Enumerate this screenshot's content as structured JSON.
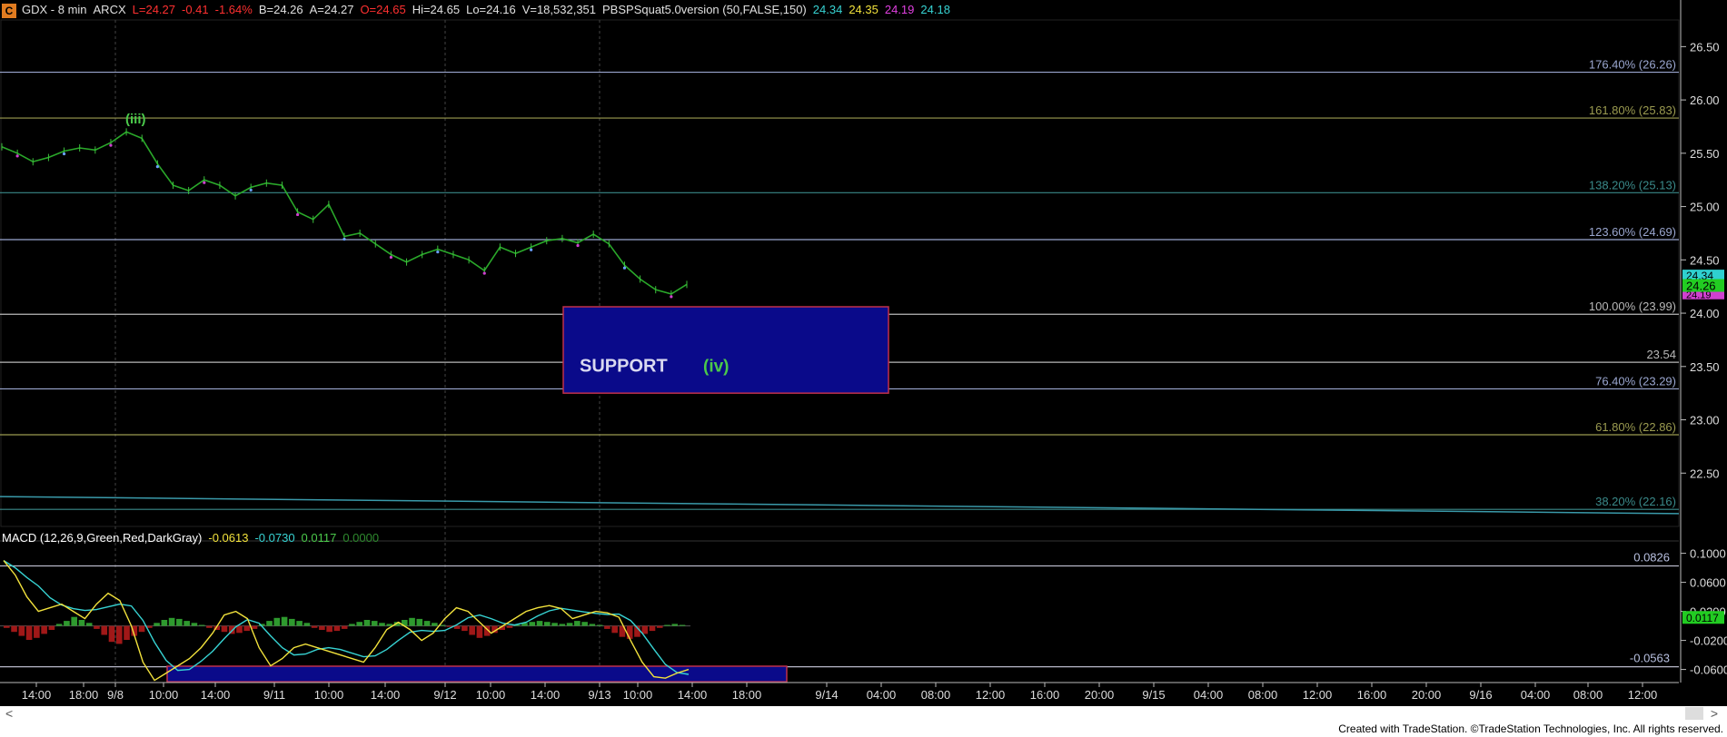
{
  "header": {
    "symbol_box": "C",
    "symbol": "GDX - 8 min",
    "exchange": "ARCX",
    "last": "L=24.27",
    "change": "-0.41",
    "change_pct": "-1.64%",
    "bid": "B=24.26",
    "ask": "A=24.27",
    "open": "O=24.65",
    "high": "Hi=24.65",
    "low": "Lo=24.16",
    "volume": "V=18,532,351",
    "indicator": "PBSPSquat5.0version (50,FALSE,150)",
    "ind_values": [
      "24.34",
      "24.35",
      "24.19",
      "24.18"
    ],
    "ind_colors": [
      "#37d3d3",
      "#f2e23c",
      "#e040e0",
      "#37d3d3"
    ]
  },
  "macd_header": {
    "title": "MACD (12,26,9,Green,Red,DarkGray)",
    "values": [
      "-0.0613",
      "-0.0730",
      "0.0117",
      "0.0000"
    ],
    "colors": [
      "#f2e23c",
      "#37d3d3",
      "#4bc94b",
      "#2e8a2e"
    ]
  },
  "chart_data": {
    "type": "line",
    "title": "GDX - 8 min",
    "price_axis": {
      "ticks": [
        "26.50",
        "26.00",
        "25.50",
        "25.00",
        "24.50",
        "24.00",
        "23.50",
        "23.00",
        "22.50"
      ],
      "ylim": [
        22.0,
        26.75
      ]
    },
    "macd_axis": {
      "ticks": [
        "0.1000",
        "0.0600",
        "0.0200",
        "-0.0200",
        "-0.0600"
      ],
      "ylim": [
        -0.078,
        0.112
      ]
    },
    "x_ticks": [
      "14:00",
      "18:00",
      "9/8",
      "10:00",
      "14:00",
      "9/11",
      "10:00",
      "14:00",
      "9/12",
      "10:00",
      "14:00",
      "9/13",
      "10:00",
      "14:00",
      "18:00",
      "9/14",
      "04:00",
      "08:00",
      "12:00",
      "16:00",
      "20:00",
      "9/15",
      "04:00",
      "08:00",
      "12:00",
      "16:00",
      "20:00",
      "9/16",
      "04:00",
      "08:00",
      "12:00"
    ],
    "fib_levels": [
      {
        "label": "176.40% (26.26)",
        "value": 26.26,
        "color": "#9aa6cf"
      },
      {
        "label": "161.80% (25.83)",
        "value": 25.83,
        "color": "#9b9b50"
      },
      {
        "label": "138.20% (25.13)",
        "value": 25.13,
        "color": "#3a8a8a"
      },
      {
        "label": "123.60% (24.69)",
        "value": 24.69,
        "color": "#9aa6cf"
      },
      {
        "label": "100.00% (23.99)",
        "value": 23.99,
        "color": "#b8b8b8"
      },
      {
        "label": "23.54",
        "value": 23.54,
        "color": "#b8b8b8"
      },
      {
        "label": "76.40% (23.29)",
        "value": 23.29,
        "color": "#9aa6cf"
      },
      {
        "label": "61.80% (22.86)",
        "value": 22.86,
        "color": "#9b9b50"
      },
      {
        "label": "38.20% (22.16)",
        "value": 22.16,
        "color": "#3a8a8a"
      }
    ],
    "macd_levels": [
      {
        "label": "0.0826",
        "value": 0.0826
      },
      {
        "label": "-0.0563",
        "value": -0.0563
      }
    ],
    "price_series": [
      25.56,
      25.5,
      25.42,
      25.46,
      25.52,
      25.55,
      25.53,
      25.6,
      25.7,
      25.64,
      25.4,
      25.2,
      25.15,
      25.25,
      25.2,
      25.1,
      25.18,
      25.22,
      25.2,
      24.95,
      24.88,
      25.02,
      24.72,
      24.75,
      24.65,
      24.55,
      24.48,
      24.55,
      24.6,
      24.55,
      24.5,
      24.4,
      24.62,
      24.56,
      24.62,
      24.68,
      24.7,
      24.66,
      24.74,
      24.65,
      24.45,
      24.32,
      24.22,
      24.18,
      24.27
    ],
    "price_labels": {
      "last": "24.26",
      "upper": "24.34",
      "lower": "24.19"
    },
    "macd_labels": {
      "value": "0.0117",
      "signal": "0.0200"
    },
    "annotations": [
      {
        "text": "(iii)",
        "color": "#4bc94b"
      },
      {
        "text": "SUPPORT",
        "color": "#d9d9f0"
      },
      {
        "text": "(iv)",
        "color": "#4bc94b"
      }
    ]
  },
  "footer": {
    "credit": "Created with TradeStation. ©TradeStation Technologies, Inc. All rights reserved."
  },
  "scrollbar": {
    "left": "<",
    "right": ">"
  }
}
